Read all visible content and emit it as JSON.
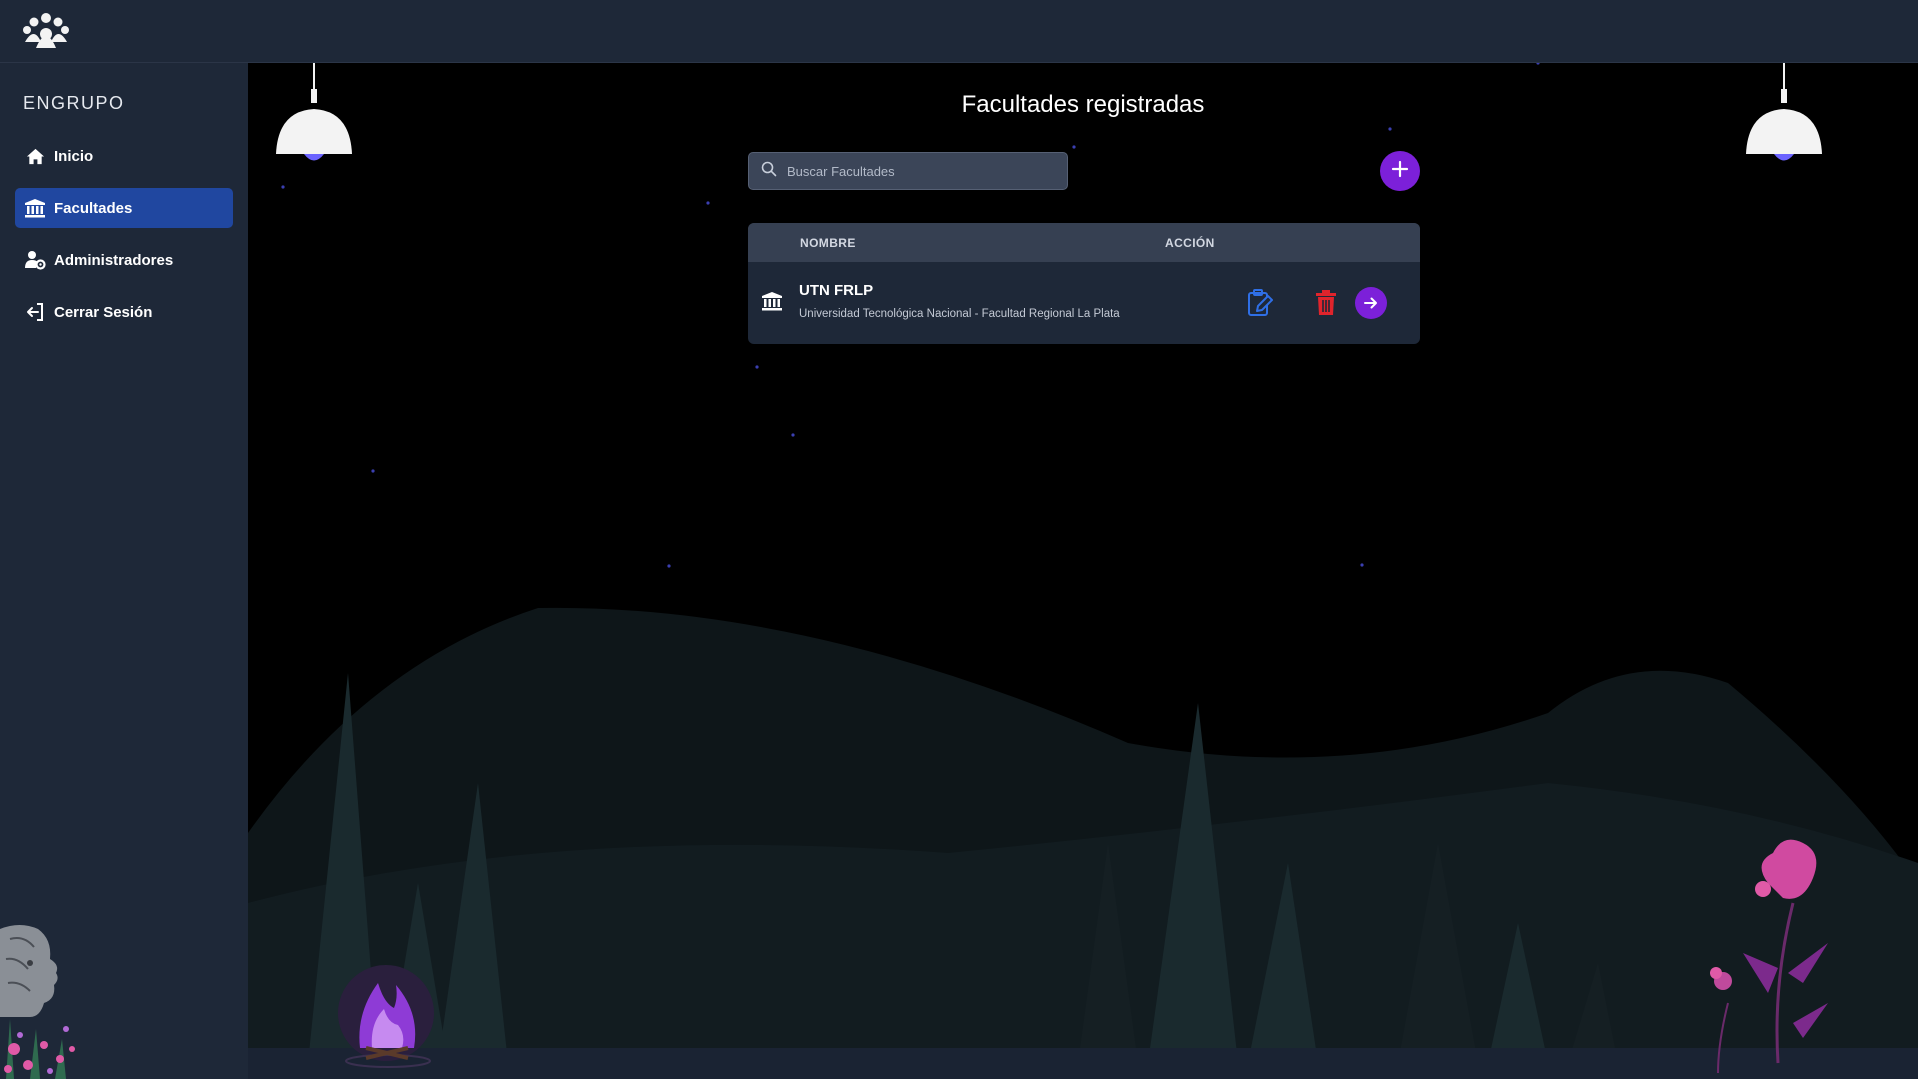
{
  "app": {
    "brand": "ENGRUPO"
  },
  "sidebar": {
    "items": [
      {
        "label": "Inicio",
        "icon": "home-icon"
      },
      {
        "label": "Facultades",
        "icon": "institution-icon",
        "active": true
      },
      {
        "label": "Administradores",
        "icon": "users-gear-icon"
      },
      {
        "label": "Cerrar Sesión",
        "icon": "logout-icon"
      }
    ]
  },
  "main": {
    "title": "Facultades registradas",
    "search": {
      "placeholder": "Buscar Facultades",
      "value": ""
    },
    "table": {
      "columns": [
        "NOMBRE",
        "ACCIÓN"
      ],
      "rows": [
        {
          "name": "UTN FRLP",
          "description": "Universidad Tecnológica Nacional - Facultad Regional La Plata",
          "actions": [
            "edit-icon",
            "delete-icon",
            "open-arrow-icon"
          ]
        }
      ]
    }
  },
  "colors": {
    "sidebar_bg": "#1e2838",
    "active_item": "#2047a0",
    "accent_purple": "#7c20d9",
    "edit_blue": "#2f6fe6",
    "delete_red": "#e0242c",
    "background": "#000000"
  }
}
